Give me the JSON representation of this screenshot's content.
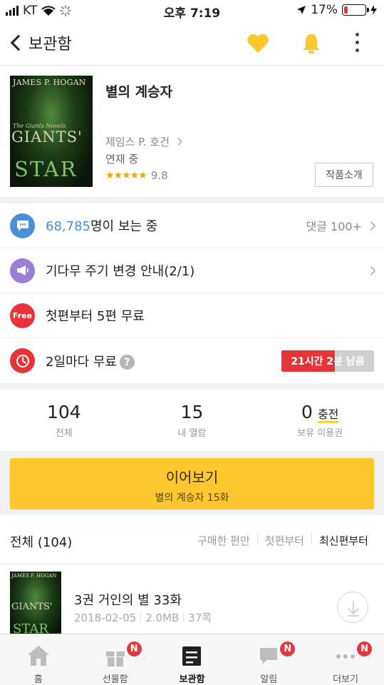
{
  "status_bar": {
    "carrier": "KT",
    "time": "오후 7:19",
    "battery_percent": "17%",
    "battery_level": 0.17
  },
  "nav": {
    "back_label": "보관함"
  },
  "book": {
    "title": "별의 계승자",
    "author": "제임스 P. 호건",
    "serial_status": "연재 중",
    "stars": "★★★★★",
    "rating": "9.8",
    "intro_button": "작품소개",
    "cover": {
      "author": "JAMES P. HOGAN",
      "series": "The Giants Novels",
      "word1": "GIANTS'",
      "word2": "STAR"
    }
  },
  "info": {
    "viewers_count": "68,785",
    "viewers_suffix": "명이 보는 중",
    "comments": "댓글 100+",
    "notice": "기다무 주기 변경 안내(2/1)",
    "free_badge": "Free",
    "free_text": "첫편부터 5편 무료",
    "wait_free_text": "2일마다 무료",
    "help": "?",
    "timer": "21시간 2분 남음",
    "timer_progress": 0.58
  },
  "stats": [
    {
      "value": "104",
      "suffix": "",
      "label": "전체"
    },
    {
      "value": "15",
      "suffix": "",
      "label": "내 열람"
    },
    {
      "value": "0",
      "suffix": "충전",
      "label": "보유 이용권"
    }
  ],
  "continue": {
    "title": "이어보기",
    "subtitle": "별의 계승자 15화"
  },
  "list": {
    "title": "전체 (104)",
    "sort_options": [
      "구매한 편만",
      "첫편부터",
      "최신편부터"
    ],
    "active_sort": 2
  },
  "episode": {
    "title": "3권 거인의 별 33화",
    "date": "2018-02-05",
    "size": "2.0MB",
    "pages": "37쪽"
  },
  "tabs": [
    {
      "label": "홈",
      "badge": ""
    },
    {
      "label": "선물함",
      "badge": "N"
    },
    {
      "label": "보관함",
      "badge": ""
    },
    {
      "label": "알림",
      "badge": "N"
    },
    {
      "label": "더보기",
      "badge": "N"
    }
  ],
  "colors": {
    "accent_yellow": "#fdc82f",
    "link_blue": "#4a90d9",
    "alert_red": "#e5353b",
    "notice_purple": "#9b7fd6"
  }
}
